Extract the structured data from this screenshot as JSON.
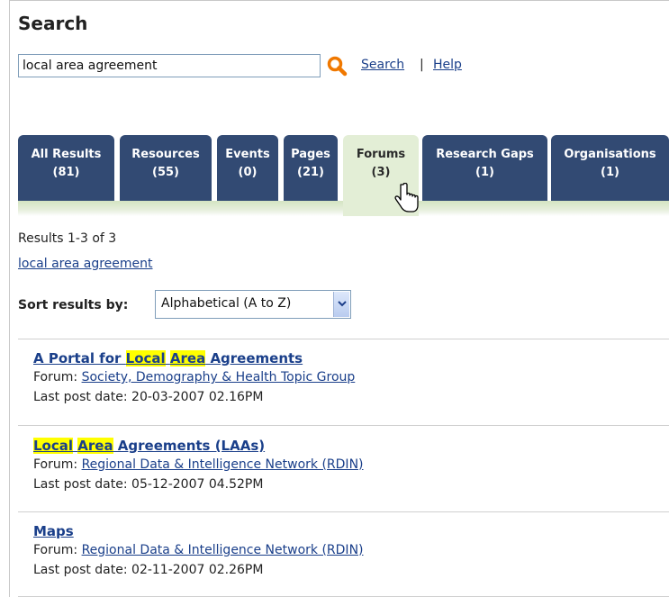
{
  "page": {
    "heading": "Search"
  },
  "search": {
    "query": "local area agreement",
    "search_label": "Search",
    "separator": "|",
    "help_label": "Help"
  },
  "tabs": [
    {
      "label": "All Results",
      "count": "(81)",
      "active": false
    },
    {
      "label": "Resources",
      "count": "(55)",
      "active": false
    },
    {
      "label": "Events",
      "count": "(0)",
      "active": false
    },
    {
      "label": "Pages",
      "count": "(21)",
      "active": false
    },
    {
      "label": "Forums",
      "count": "(3)",
      "active": true
    },
    {
      "label": "Research Gaps",
      "count": "(1)",
      "active": false
    },
    {
      "label": "Organisations",
      "count": "(1)",
      "active": false
    }
  ],
  "results_summary": "Results 1-3 of 3",
  "query_link": "local area agreement",
  "sort": {
    "label": "Sort results by:",
    "selected": "Alphabetical (A to Z)"
  },
  "results": [
    {
      "title_parts": [
        {
          "text": "A Portal for ",
          "highlight": false
        },
        {
          "text": "Local",
          "highlight": true
        },
        {
          "text": " ",
          "highlight": false
        },
        {
          "text": "Area",
          "highlight": true
        },
        {
          "text": " Agreements",
          "highlight": false
        }
      ],
      "forum_label": "Forum:",
      "forum": "Society, Demography & Health Topic Group",
      "last_post": "Last post date: 20-03-2007 02.16PM"
    },
    {
      "title_parts": [
        {
          "text": "Local",
          "highlight": true
        },
        {
          "text": " ",
          "highlight": false
        },
        {
          "text": "Area",
          "highlight": true
        },
        {
          "text": " Agreements (LAAs)",
          "highlight": false
        }
      ],
      "forum_label": "Forum:",
      "forum": "Regional Data & Intelligence Network (RDIN)",
      "last_post": "Last post date: 05-12-2007 04.52PM"
    },
    {
      "title_parts": [
        {
          "text": "Maps",
          "highlight": false
        }
      ],
      "forum_label": "Forum:",
      "forum": "Regional Data & Intelligence Network (RDIN)",
      "last_post": "Last post date: 02-11-2007 02.26PM"
    }
  ],
  "colors": {
    "tab_bg": "#324a73",
    "tab_active_bg": "#e3eed6",
    "link": "#1a3f8a",
    "highlight": "#ffff00",
    "search_icon": "#f07800"
  },
  "icons": [
    "search-icon",
    "chevron-down-icon",
    "hand-pointer-icon"
  ]
}
